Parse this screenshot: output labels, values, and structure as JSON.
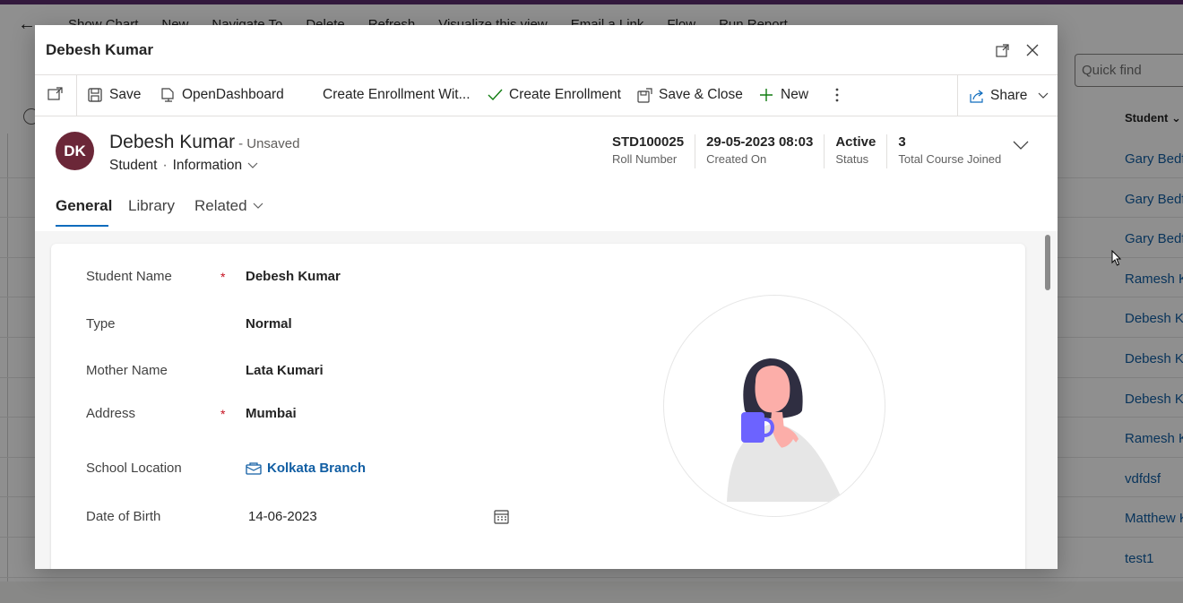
{
  "background": {
    "cmdbar": [
      "Show Chart",
      "New",
      "Navigate To",
      "Delete",
      "Refresh",
      "Visualize this view",
      "Email a Link",
      "Flow",
      "Run Report"
    ],
    "quick_find_placeholder": "Quick find",
    "column_header": "Student",
    "rows": [
      "Gary Bedford",
      "Gary Bedford",
      "Gary Bedford",
      "Ramesh Kumar",
      "Debesh Kumar",
      "Debesh Kumar",
      "Debesh Kumar",
      "Ramesh Kumar",
      "vdfdsf",
      "Matthew Kim",
      "test1"
    ]
  },
  "dialog": {
    "title": "Debesh Kumar"
  },
  "toolbar": {
    "save": "Save",
    "open_dashboard": "OpenDashboard",
    "create_enrollment_with": "Create Enrollment Wit...",
    "create_enrollment": "Create Enrollment",
    "save_close": "Save & Close",
    "new": "New",
    "share": "Share"
  },
  "header": {
    "avatar_initials": "DK",
    "name": "Debesh Kumar",
    "unsaved": "- Unsaved",
    "entity": "Student",
    "form": "Information",
    "fields": [
      {
        "value": "STD100025",
        "label": "Roll Number"
      },
      {
        "value": "29-05-2023 08:03",
        "label": "Created On"
      },
      {
        "value": "Active",
        "label": "Status"
      },
      {
        "value": "3",
        "label": "Total Course Joined"
      }
    ]
  },
  "tabs": {
    "general": "General",
    "library": "Library",
    "related": "Related"
  },
  "form": {
    "required_mark": "*",
    "student_name": {
      "label": "Student Name",
      "value": "Debesh Kumar"
    },
    "type": {
      "label": "Type",
      "value": "Normal"
    },
    "mother_name": {
      "label": "Mother Name",
      "value": "Lata Kumari"
    },
    "address": {
      "label": "Address",
      "value": "Mumbai"
    },
    "school_location": {
      "label": "School Location",
      "value": "Kolkata Branch"
    },
    "date_of_birth": {
      "label": "Date of Birth",
      "value": "14-06-2023"
    }
  },
  "colors": {
    "accent": "#0f6cbd",
    "avatar_bg": "#6b2738",
    "required": "#c50f1f",
    "link": "#115ea3"
  }
}
